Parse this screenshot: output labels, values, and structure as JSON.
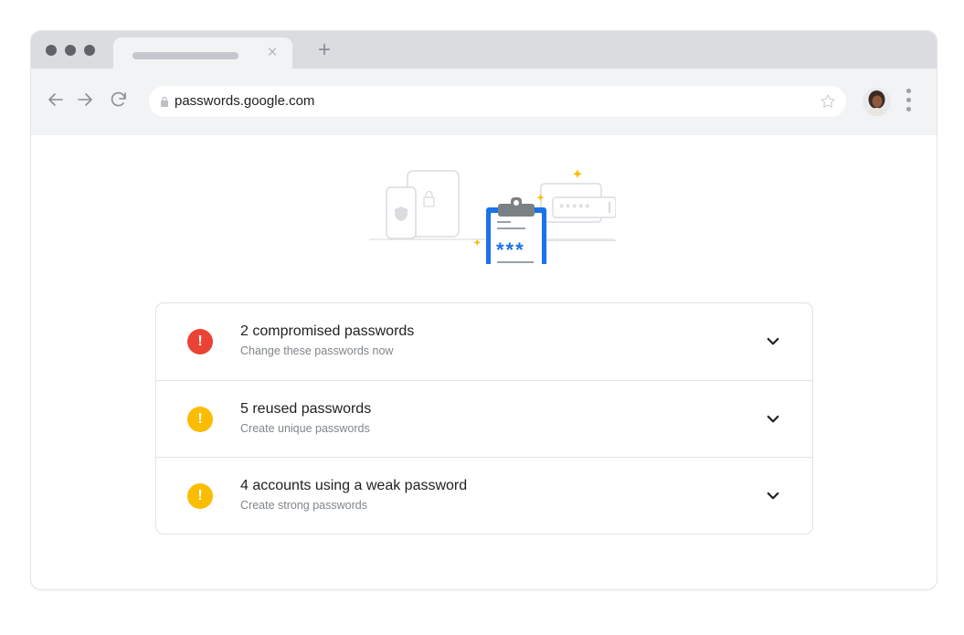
{
  "browser": {
    "url": "passwords.google.com",
    "tab_close": "×",
    "new_tab": "+"
  },
  "checkup": {
    "items": [
      {
        "title": "2 compromised passwords",
        "subtitle": "Change these passwords now",
        "status": "error",
        "icon": "alert-icon",
        "color": "#ea4335",
        "glyph": "!"
      },
      {
        "title": "5 reused passwords",
        "subtitle": "Create unique passwords",
        "status": "warning",
        "icon": "alert-icon",
        "color": "#fbbc04",
        "glyph": "!"
      },
      {
        "title": "4 accounts using a weak password",
        "subtitle": "Create strong passwords",
        "status": "warning",
        "icon": "alert-icon",
        "color": "#fbbc04",
        "glyph": "!"
      }
    ]
  },
  "illustration": {
    "password_mask": "***",
    "field_mask": "*****"
  },
  "colors": {
    "accent_blue": "#1a73e8",
    "error_red": "#ea4335",
    "warning_yellow": "#fbbc04"
  }
}
